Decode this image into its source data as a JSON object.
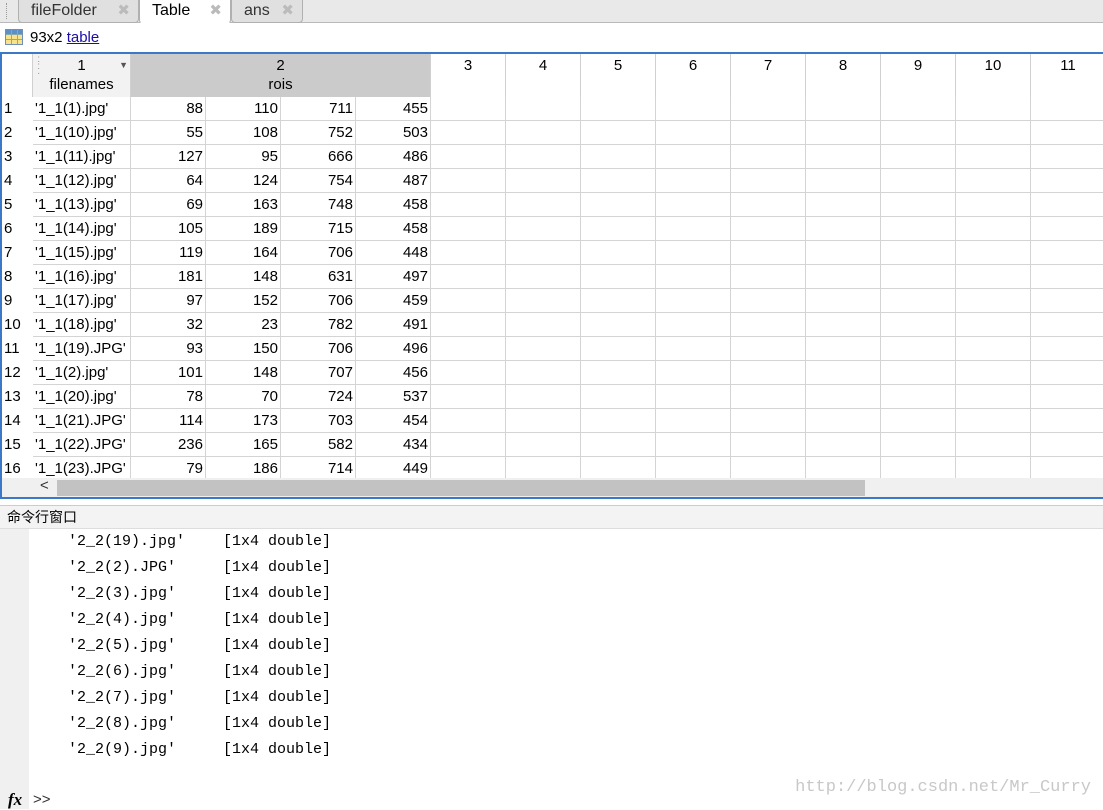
{
  "tabs": [
    {
      "label": "fileFolder",
      "active": false
    },
    {
      "label": "Table",
      "active": true
    },
    {
      "label": "ans",
      "active": false
    }
  ],
  "info": {
    "size": "93x2",
    "type_link": "table"
  },
  "table": {
    "col1": {
      "index": "1",
      "name": "filenames"
    },
    "col2": {
      "index": "2",
      "name": "rois"
    },
    "extra_cols": [
      "3",
      "4",
      "5",
      "6",
      "7",
      "8",
      "9",
      "10",
      "11"
    ],
    "rows": [
      {
        "n": "1",
        "f": "'1_1(1).jpg'",
        "r": [
          88,
          110,
          711,
          455
        ]
      },
      {
        "n": "2",
        "f": "'1_1(10).jpg'",
        "r": [
          55,
          108,
          752,
          503
        ]
      },
      {
        "n": "3",
        "f": "'1_1(11).jpg'",
        "r": [
          127,
          95,
          666,
          486
        ]
      },
      {
        "n": "4",
        "f": "'1_1(12).jpg'",
        "r": [
          64,
          124,
          754,
          487
        ]
      },
      {
        "n": "5",
        "f": "'1_1(13).jpg'",
        "r": [
          69,
          163,
          748,
          458
        ]
      },
      {
        "n": "6",
        "f": "'1_1(14).jpg'",
        "r": [
          105,
          189,
          715,
          458
        ]
      },
      {
        "n": "7",
        "f": "'1_1(15).jpg'",
        "r": [
          119,
          164,
          706,
          448
        ]
      },
      {
        "n": "8",
        "f": "'1_1(16).jpg'",
        "r": [
          181,
          148,
          631,
          497
        ]
      },
      {
        "n": "9",
        "f": "'1_1(17).jpg'",
        "r": [
          97,
          152,
          706,
          459
        ]
      },
      {
        "n": "10",
        "f": "'1_1(18).jpg'",
        "r": [
          32,
          23,
          782,
          491
        ]
      },
      {
        "n": "11",
        "f": "'1_1(19).JPG'",
        "r": [
          93,
          150,
          706,
          496
        ]
      },
      {
        "n": "12",
        "f": "'1_1(2).jpg'",
        "r": [
          101,
          148,
          707,
          456
        ]
      },
      {
        "n": "13",
        "f": "'1_1(20).jpg'",
        "r": [
          78,
          70,
          724,
          537
        ]
      },
      {
        "n": "14",
        "f": "'1_1(21).JPG'",
        "r": [
          114,
          173,
          703,
          454
        ]
      },
      {
        "n": "15",
        "f": "'1_1(22).JPG'",
        "r": [
          236,
          165,
          582,
          434
        ]
      },
      {
        "n": "16",
        "f": "'1_1(23).JPG'",
        "r": [
          79,
          186,
          714,
          449
        ]
      }
    ]
  },
  "scroll_left": "<",
  "command": {
    "title": "命令行窗口",
    "lines": [
      {
        "name": "'2_2(19).jpg'",
        "type": "[1x4 double]"
      },
      {
        "name": "'2_2(2).JPG'",
        "type": "[1x4 double]"
      },
      {
        "name": "'2_2(3).jpg'",
        "type": "[1x4 double]"
      },
      {
        "name": "'2_2(4).jpg'",
        "type": "[1x4 double]"
      },
      {
        "name": "'2_2(5).jpg'",
        "type": "[1x4 double]"
      },
      {
        "name": "'2_2(6).jpg'",
        "type": "[1x4 double]"
      },
      {
        "name": "'2_2(7).jpg'",
        "type": "[1x4 double]"
      },
      {
        "name": "'2_2(8).jpg'",
        "type": "[1x4 double]"
      },
      {
        "name": "'2_2(9).jpg'",
        "type": "[1x4 double]"
      }
    ],
    "fx": "fx",
    "prompt": ">>"
  },
  "watermark": "http://blog.csdn.net/Mr_Curry"
}
